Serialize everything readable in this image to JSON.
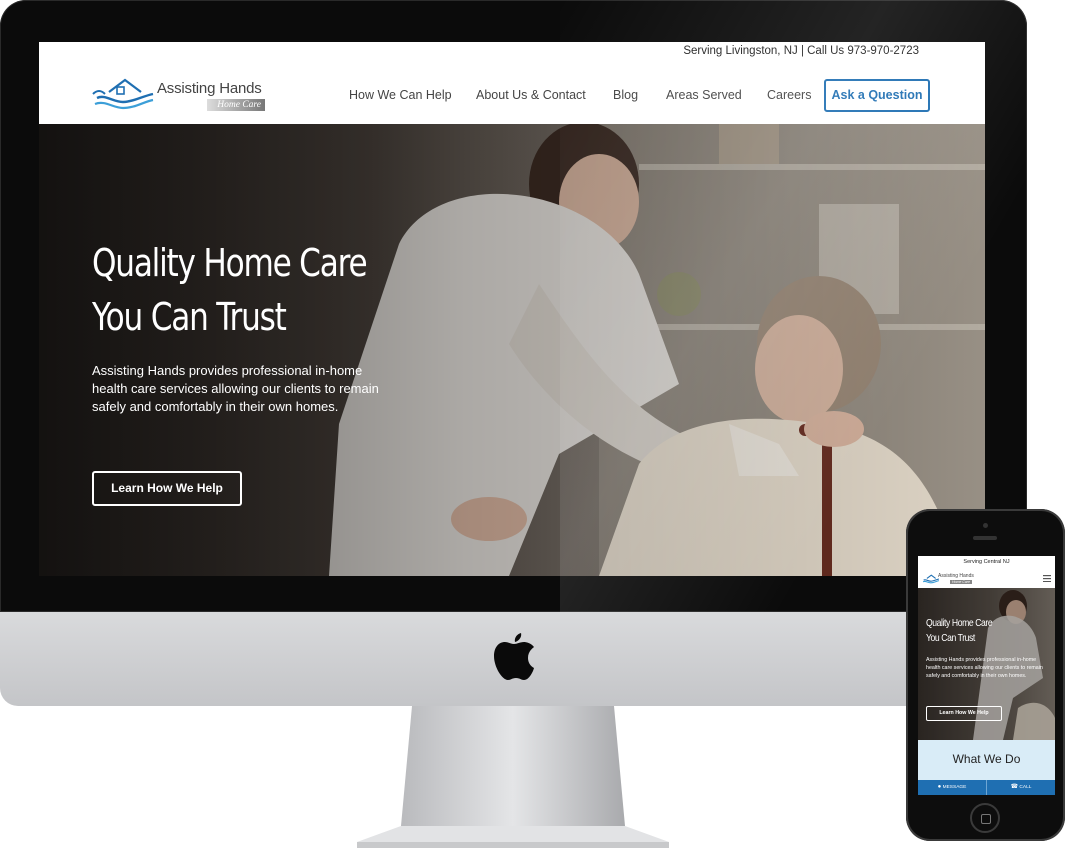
{
  "site": {
    "topbar_contact": "Serving Livingston, NJ | Call Us 973-970-2723",
    "logo": {
      "name": "Assisting Hands",
      "tagline": "Home Care"
    },
    "nav": [
      {
        "label": "How We Can Help"
      },
      {
        "label": "About Us & Contact"
      },
      {
        "label": "Blog"
      },
      {
        "label": "Areas Served"
      },
      {
        "label": "Careers"
      }
    ],
    "cta_button": "Ask a Question",
    "hero": {
      "title_line1": "Quality Home Care",
      "title_line2": "You Can Trust",
      "description": "Assisting Hands provides professional in-home health care services allowing our clients to remain safely and comfortably in their own homes.",
      "button": "Learn How We Help"
    }
  },
  "mobile": {
    "topbar": "Serving Central NJ",
    "logo": {
      "name": "Assisting Hands",
      "tagline": "Home Care"
    },
    "hero": {
      "title_line1": "Quality Home Care",
      "title_line2": "You Can Trust",
      "description": "Assisting Hands provides professional in-home health care services allowing our clients to remain safely and comfortably in their own homes.",
      "button": "Learn How We Help"
    },
    "section_title": "What We Do",
    "bottom_bar": {
      "message": "MESSAGE",
      "call": "CALL"
    }
  },
  "icons": {
    "apple": "apple-logo-icon",
    "menu": "hamburger-menu-icon",
    "message": "chat-bubble-icon",
    "call": "phone-icon",
    "logo_mark": "house-hands-icon"
  },
  "colors": {
    "brand_blue": "#1f6fb2",
    "mobile_section_bg": "#d9ecf7"
  }
}
